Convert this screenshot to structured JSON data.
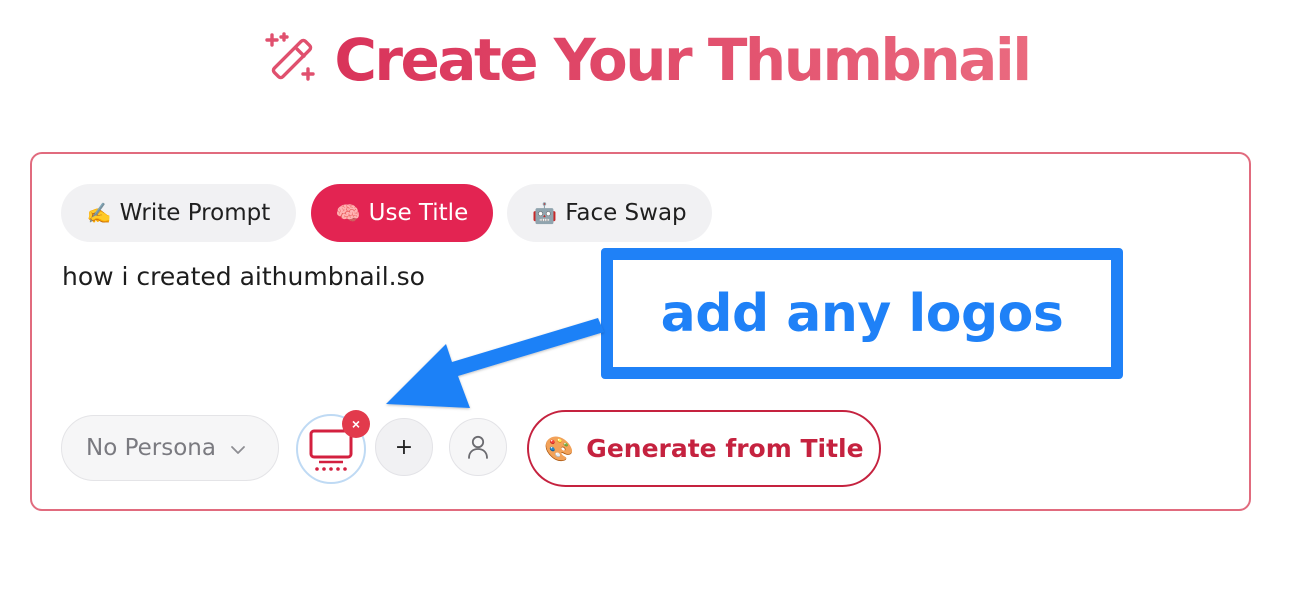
{
  "header": {
    "title": "Create Your Thumbnail",
    "icon": "magic-wand-icon"
  },
  "tabs": [
    {
      "emoji": "✍️",
      "label": "Write Prompt",
      "icon": "writing-hand-icon",
      "active": false
    },
    {
      "emoji": "🧠",
      "label": "Use Title",
      "icon": "brain-icon",
      "active": true
    },
    {
      "emoji": "🤖",
      "label": "Face Swap",
      "icon": "robot-icon",
      "active": false
    }
  ],
  "prompt": {
    "value": "how i created aithumbnail.so"
  },
  "toolbar": {
    "persona_label": "No Persona",
    "remove_symbol": "×",
    "add_symbol": "+",
    "generate_emoji": "🎨",
    "generate_label": "Generate from Title"
  },
  "annotation": {
    "text": "add any logos"
  },
  "colors": {
    "brand": "#e32452",
    "title": "#e0506e",
    "card_border": "#e16b7e",
    "annotation_blue": "#1f81f7",
    "generate_border": "#c5223f"
  }
}
